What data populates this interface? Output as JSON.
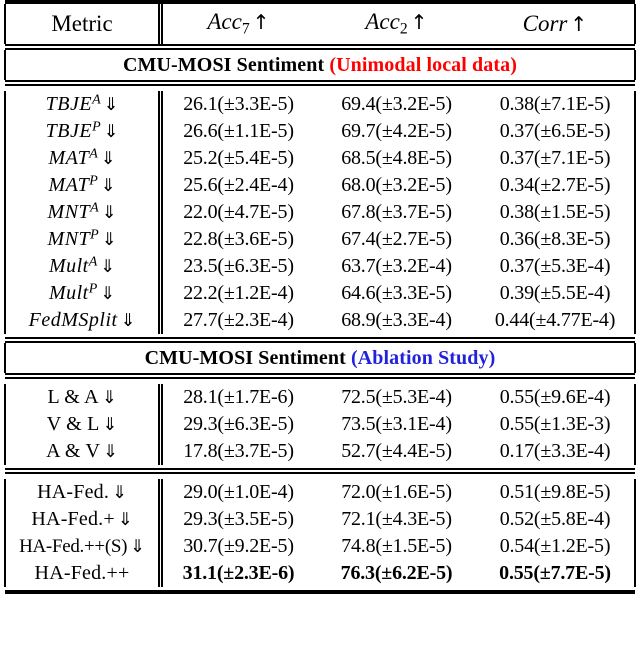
{
  "table": {
    "columns": [
      {
        "key": "metric",
        "label": "Metric",
        "style": "roman",
        "arrow": ""
      },
      {
        "key": "acc7",
        "label": "Acc",
        "sub": "7",
        "style": "math",
        "arrow": "↑"
      },
      {
        "key": "acc2",
        "label": "Acc",
        "sub": "2",
        "style": "math",
        "arrow": "↑"
      },
      {
        "key": "corr",
        "label": "Corr",
        "sub": "",
        "style": "math",
        "arrow": "↑"
      }
    ],
    "arrow_up": "↑",
    "arrow_down": "⇓",
    "plus_minus": "±",
    "colors": {
      "unimodal_tag": "#ff0000",
      "ablation_tag": "#2222dd",
      "rule": "#000000",
      "text": "#000000"
    },
    "sections": [
      {
        "id": "unimodal",
        "title": "CMU-MOSI Sentiment",
        "tag": "Unimodal local data",
        "tag_color": "red",
        "groups": [
          {
            "rows": [
              {
                "name": "TBJE",
                "sup": "A",
                "style": "math",
                "down": true,
                "acc7": "26.1(±3.3E-5)",
                "acc2": "69.4(±3.2E-5)",
                "corr": "0.38(±7.1E-5)"
              },
              {
                "name": "TBJE",
                "sup": "P",
                "style": "math",
                "down": true,
                "acc7": "26.6(±1.1E-5)",
                "acc2": "69.7(±4.2E-5)",
                "corr": "0.37(±6.5E-5)"
              },
              {
                "name": "MAT",
                "sup": "A",
                "style": "math",
                "down": true,
                "acc7": "25.2(±5.4E-5)",
                "acc2": "68.5(±4.8E-5)",
                "corr": "0.37(±7.1E-5)"
              },
              {
                "name": "MAT",
                "sup": "P",
                "style": "math",
                "down": true,
                "acc7": "25.6(±2.4E-4)",
                "acc2": "68.0(±3.2E-5)",
                "corr": "0.34(±2.7E-5)"
              },
              {
                "name": "MNT",
                "sup": "A",
                "style": "math",
                "down": true,
                "acc7": "22.0(±4.7E-5)",
                "acc2": "67.8(±3.7E-5)",
                "corr": "0.38(±1.5E-5)"
              },
              {
                "name": "MNT",
                "sup": "P",
                "style": "math",
                "down": true,
                "acc7": "22.8(±3.6E-5)",
                "acc2": "67.4(±2.7E-5)",
                "corr": "0.36(±8.3E-5)"
              },
              {
                "name": "Mult",
                "sup": "A",
                "style": "math",
                "down": true,
                "acc7": "23.5(±6.3E-5)",
                "acc2": "63.7(±3.2E-4)",
                "corr": "0.37(±5.3E-4)"
              },
              {
                "name": "Mult",
                "sup": "P",
                "style": "math",
                "down": true,
                "acc7": "22.2(±1.2E-4)",
                "acc2": "64.6(±3.3E-5)",
                "corr": "0.39(±5.5E-4)"
              },
              {
                "name": "FedMSplit",
                "sup": "",
                "style": "math",
                "down": true,
                "acc7": "27.7(±2.3E-4)",
                "acc2": "68.9(±3.3E-4)",
                "corr": "0.44(±4.77E-4)"
              }
            ]
          }
        ]
      },
      {
        "id": "ablation",
        "title": "CMU-MOSI Sentiment",
        "tag": "Ablation Study",
        "tag_color": "blue",
        "groups": [
          {
            "rows": [
              {
                "name": "L & A",
                "sup": "",
                "style": "roman",
                "down": true,
                "acc7": "28.1(±1.7E-6)",
                "acc2": "72.5(±5.3E-4)",
                "corr": "0.55(±9.6E-4)"
              },
              {
                "name": "V & L",
                "sup": "",
                "style": "roman",
                "down": true,
                "acc7": "29.3(±6.3E-5)",
                "acc2": "73.5(±3.1E-4)",
                "corr": "0.55(±1.3E-3)"
              },
              {
                "name": "A & V",
                "sup": "",
                "style": "roman",
                "down": true,
                "acc7": "17.8(±3.7E-5)",
                "acc2": "52.7(±4.4E-5)",
                "corr": "0.17(±3.3E-4)"
              }
            ]
          },
          {
            "rows": [
              {
                "name": "HA-Fed.",
                "sup": "",
                "style": "roman",
                "down": true,
                "acc7": "29.0(±1.0E-4)",
                "acc2": "72.0(±1.6E-5)",
                "corr": "0.51(±9.8E-5)"
              },
              {
                "name": "HA-Fed.+",
                "sup": "",
                "style": "roman",
                "down": true,
                "acc7": "29.3(±3.5E-5)",
                "acc2": "72.1(±4.3E-5)",
                "corr": "0.52(±5.8E-4)"
              },
              {
                "name": "HA-Fed.++(S)",
                "sup": "",
                "style": "roman-tight",
                "down": true,
                "acc7": "30.7(±9.2E-5)",
                "acc2": "74.8(±1.5E-5)",
                "corr": "0.54(±1.2E-5)"
              },
              {
                "name": "HA-Fed.++",
                "sup": "",
                "style": "roman",
                "down": false,
                "bold": true,
                "acc7": "31.1(±2.3E-6)",
                "acc2": "76.3(±6.2E-5)",
                "corr": "0.55(±7.7E-5)"
              }
            ]
          }
        ]
      }
    ]
  }
}
